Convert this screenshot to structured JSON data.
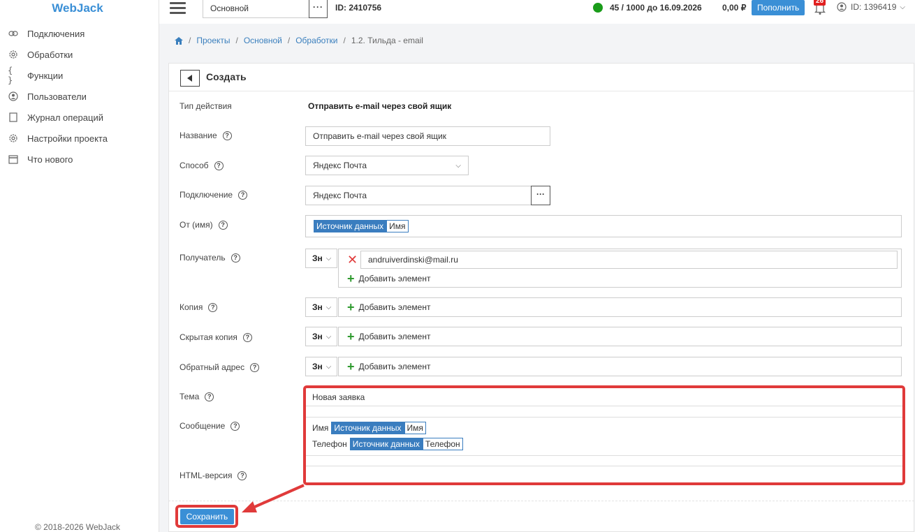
{
  "sidebar": {
    "logo": "WebJack",
    "items": [
      {
        "label": "Подключения",
        "icon": "link-icon"
      },
      {
        "label": "Обработки",
        "icon": "gear-icon"
      },
      {
        "label": "Функции",
        "icon": "braces-icon"
      },
      {
        "label": "Пользователи",
        "icon": "user-icon"
      },
      {
        "label": "Журнал операций",
        "icon": "journal-icon"
      },
      {
        "label": "Настройки проекта",
        "icon": "gear-icon"
      },
      {
        "label": "Что нового",
        "icon": "calendar-icon"
      }
    ],
    "copyright": "© 2018-2026 WebJack"
  },
  "topbar": {
    "project": "Основной",
    "project_id": "ID: 2410756",
    "limit": "45 / 1000 до 16.09.2026",
    "balance": "0,00 ₽",
    "topup_label": "Пополнить",
    "notifications": "26",
    "user_id": "ID: 1396419",
    "status_color": "#1a9c1a"
  },
  "breadcrumb": {
    "items": [
      "Проекты",
      "Основной",
      "Обработки",
      "1.2. Тильда - email"
    ]
  },
  "form": {
    "title": "Создать",
    "action_type_label": "Тип действия",
    "action_type_value": "Отправить e-mail через свой ящик",
    "name_label": "Название",
    "name_value": "Отправить e-mail через свой ящик",
    "method_label": "Способ",
    "method_value": "Яндекс Почта",
    "connection_label": "Подключение",
    "connection_value": "Яндекс Почта",
    "from_label": "От (имя)",
    "from_tag_source": "Источник данных",
    "from_tag_field": "Имя",
    "recipient_label": "Получатель",
    "recipient_value": "andruiverdinski@mail.ru",
    "zn": "Зн",
    "add_element": "Добавить элемент",
    "copy_label": "Копия",
    "bcc_label": "Скрытая копия",
    "reply_label": "Обратный адрес",
    "subject_label": "Тема",
    "subject_value": "Новая заявка",
    "message_label": "Сообщение",
    "message_line1_prefix": "Имя",
    "message_line1_source": "Источник данных",
    "message_line1_field": "Имя",
    "message_line2_prefix": "Телефон",
    "message_line2_source": "Источник данных",
    "message_line2_field": "Телефон",
    "html_label": "HTML-версия",
    "save_label": "Сохранить"
  },
  "colors": {
    "accent": "#3a8fd6",
    "tag": "#3a7dbf",
    "highlight": "#e03a3a",
    "add": "#2e9a2e"
  }
}
